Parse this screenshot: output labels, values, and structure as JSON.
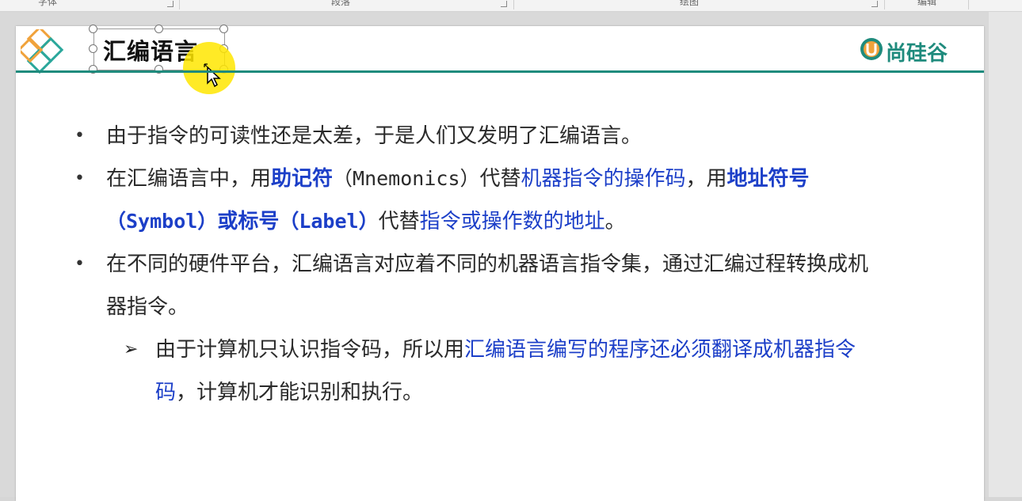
{
  "ribbon": {
    "groups": [
      "字体",
      "段落",
      "绘图",
      "编辑"
    ]
  },
  "slide": {
    "title": "汇编语言",
    "brand": "尚硅谷",
    "brand_mark": "U",
    "bullet_symbol": "•",
    "sub_bullet_symbol": "➢",
    "bullets": [
      {
        "parts": [
          {
            "text": "由于指令的可读性还是太差，于是人们又发明了汇编语言。"
          }
        ]
      },
      {
        "parts": [
          {
            "text": "在汇编语言中，用"
          },
          {
            "text": "助记符",
            "style": "blue bold"
          },
          {
            "text": "（Mnemonics）",
            "style": "mono"
          },
          {
            "text": "代替"
          },
          {
            "text": "机器指令的操作码",
            "style": "blue"
          },
          {
            "text": "，用"
          },
          {
            "text": "地址符号",
            "style": "blue bold"
          },
          {
            "text": "（Symbol）",
            "style": "blue bold mono"
          },
          {
            "text": "或标号",
            "style": "blue bold"
          },
          {
            "text": "（Label）",
            "style": "blue bold mono"
          },
          {
            "text": "代替"
          },
          {
            "text": "指令或操作数的地址",
            "style": "blue"
          },
          {
            "text": "。"
          }
        ]
      },
      {
        "parts": [
          {
            "text": "在不同的硬件平台，汇编语言对应着不同的机器语言指令集，通过汇编过程转换成机器指令。"
          }
        ]
      }
    ],
    "sub_bullets": [
      {
        "parts": [
          {
            "text": "由于计算机只认识指令码，所以用"
          },
          {
            "text": "汇编语言编写的程序还必须翻译成机器指令码",
            "style": "blue"
          },
          {
            "text": "，计算机才能识别和执行。"
          }
        ]
      }
    ]
  },
  "colors": {
    "accent": "#1f8b7d",
    "emphasis": "#1c3fc8",
    "logo_orange": "#f0a23b",
    "logo_teal": "#2aa79b"
  }
}
